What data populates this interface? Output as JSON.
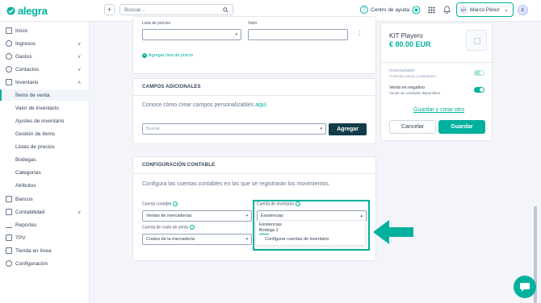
{
  "brand": {
    "name": "alegra",
    "accent": "#00b19d",
    "dark_button": "#123c4a"
  },
  "topbar": {
    "search_placeholder": "Buscar...",
    "help_label": "Centro de ayuda",
    "user_initials": "MP",
    "user_name": "Marco Pérez",
    "extra_avatar": "E"
  },
  "sidebar": {
    "items": [
      {
        "label": "Inicio",
        "icon": "home-icon"
      },
      {
        "label": "Ingresos",
        "icon": "income-icon",
        "chev": "∨"
      },
      {
        "label": "Gastos",
        "icon": "expenses-icon",
        "chev": "∨"
      },
      {
        "label": "Contactos",
        "icon": "contacts-icon",
        "chev": "∨"
      },
      {
        "label": "Inventario",
        "icon": "inventory-icon",
        "chev": "∧"
      }
    ],
    "inventory_sub": [
      {
        "label": "Ítems de venta",
        "active": true
      },
      {
        "label": "Valor de inventario"
      },
      {
        "label": "Ajustes de inventario"
      },
      {
        "label": "Gestión de ítems"
      },
      {
        "label": "Listas de precios"
      },
      {
        "label": "Bodegas"
      },
      {
        "label": "Categorías"
      },
      {
        "label": "Atributos"
      }
    ],
    "items_bottom": [
      {
        "label": "Bancos",
        "icon": "bank-icon"
      },
      {
        "label": "Contabilidad",
        "icon": "accounting-icon",
        "chev": "∨"
      },
      {
        "label": "Reportes",
        "icon": "reports-icon"
      },
      {
        "label": "TPV",
        "icon": "pos-icon"
      },
      {
        "label": "Tienda en línea",
        "icon": "store-icon"
      },
      {
        "label": "Configuración",
        "icon": "settings-icon"
      }
    ]
  },
  "price_list": {
    "label_list": "Lista de precios",
    "label_value": "Valor",
    "add_link": "Agregar lista de precio"
  },
  "extra_fields": {
    "title": "CAMPOS ADICIONALES",
    "text": "Conoce cómo crear campos personalizables",
    "link": "aquí.",
    "search_placeholder": "Buscar",
    "add_button": "Agregar"
  },
  "accounting": {
    "title": "CONFIGURACIÓN CONTABLE",
    "text": "Configura las cuentas contables en las que se registrarán los movimientos.",
    "sales_account_label": "Cuenta contable",
    "sales_account_value": "Ventas de mercaderías",
    "cost_account_label": "Cuenta de costo de venta",
    "cost_account_value": "Costos de la mercadería",
    "inventory_account_label": "Cuenta de inventario",
    "inventory_account_value": "Existencias",
    "dropdown_options": [
      "Existencias",
      "Bodega 1"
    ],
    "dropdown_link": "Configurar cuentas de inventario"
  },
  "product_panel": {
    "name": "KIT Playero",
    "price": "€ 80.00 EUR",
    "inventariable_label": "Inventariable",
    "inventariable_sub": "Controla costos y cantidades",
    "negative_label": "Venta en negativo",
    "negative_sub": "Vende sin unidades disponibles",
    "save_create_link": "Guardar y crear otro",
    "cancel": "Cancelar",
    "save": "Guardar"
  }
}
